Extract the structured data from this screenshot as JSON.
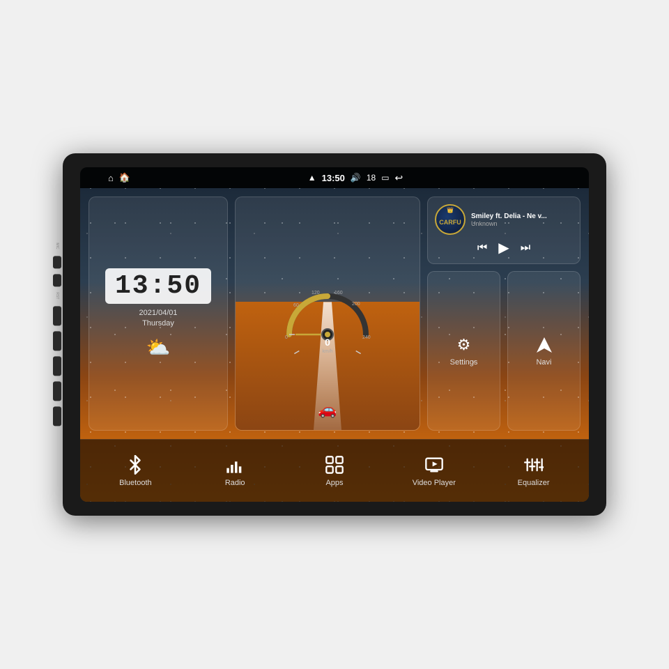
{
  "device": {
    "mic_label": "MIC",
    "rst_label": "RST"
  },
  "status_bar": {
    "wifi_icon": "▼",
    "time": "13:50",
    "volume_icon": "🔊",
    "volume_level": "18",
    "window_icon": "▭",
    "back_icon": "↩"
  },
  "clock": {
    "time": "13:50",
    "date": "2021/04/01",
    "day": "Thursday"
  },
  "music": {
    "title": "Smiley ft. Delia - Ne v...",
    "artist": "Unknown",
    "album_label": "CARFU"
  },
  "widgets": {
    "settings_label": "Settings",
    "navi_label": "Navi"
  },
  "bottom_items": [
    {
      "label": "Bluetooth",
      "icon": "bluetooth"
    },
    {
      "label": "Radio",
      "icon": "radio"
    },
    {
      "label": "Apps",
      "icon": "apps"
    },
    {
      "label": "Video Player",
      "icon": "video"
    },
    {
      "label": "Equalizer",
      "icon": "equalizer"
    }
  ],
  "speedometer": {
    "value": "0",
    "unit": "km/h"
  }
}
